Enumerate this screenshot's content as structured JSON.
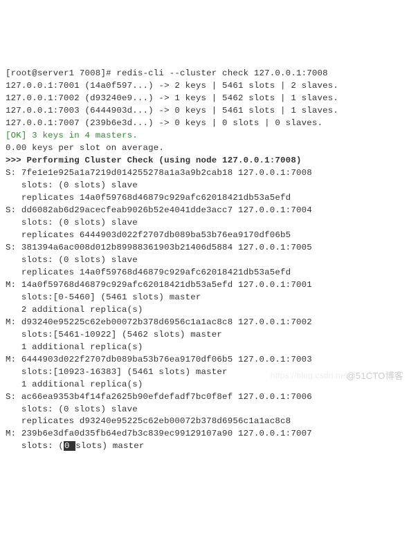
{
  "prompt": "[root@server1 7008]# redis-cli --cluster check 127.0.0.1:7008",
  "summary": [
    "127.0.0.1:7001 (14a0f597...) -> 2 keys | 5461 slots | 2 slaves.",
    "127.0.0.1:7002 (d93240e9...) -> 1 keys | 5462 slots | 1 slaves.",
    "127.0.0.1:7003 (6444903d...) -> 0 keys | 5461 slots | 1 slaves.",
    "127.0.0.1:7007 (239b6e3d...) -> 0 keys | 0 slots | 0 slaves."
  ],
  "ok_line": "[OK] 3 keys in 4 masters.",
  "avg_line": "0.00 keys per slot on average.",
  "perf_line": ">>> Performing Cluster Check (using node 127.0.0.1:7008)",
  "nodes": [
    "S: 7fe1e1e925a1a7219d014255278a1a3a9b2cab18 127.0.0.1:7008",
    "   slots: (0 slots) slave",
    "   replicates 14a0f59768d46879c929afc62018421db53a5efd",
    "S: dd6082ab6d29acecfeab9026b52e4041dde3acc7 127.0.0.1:7004",
    "   slots: (0 slots) slave",
    "   replicates 6444903d022f2707db089ba53b76ea9170df06b5",
    "S: 381394a6ac008d012b89988361903b21406d5884 127.0.0.1:7005",
    "   slots: (0 slots) slave",
    "   replicates 14a0f59768d46879c929afc62018421db53a5efd",
    "M: 14a0f59768d46879c929afc62018421db53a5efd 127.0.0.1:7001",
    "   slots:[0-5460] (5461 slots) master",
    "   2 additional replica(s)",
    "M: d93240e95225c62eb00072b378d6956c1a1ac8c8 127.0.0.1:7002",
    "   slots:[5461-10922] (5462 slots) master",
    "   1 additional replica(s)",
    "M: 6444903d022f2707db089ba53b76ea9170df06b5 127.0.0.1:7003",
    "   slots:[10923-16383] (5461 slots) master",
    "   1 additional replica(s)",
    "S: ac66ea9353b4f14fa2625b90efdefadf7bc0f8ef 127.0.0.1:7006",
    "   slots: (0 slots) slave",
    "   replicates d93240e95225c62eb00072b378d6956c1a1ac8c8",
    "M: 239b6e3dfa0d35fb64ed7b3c839ec99129107a90 127.0.0.1:7007"
  ],
  "last_line_prefix": "   slots: (",
  "last_line_highlight": "0 ",
  "last_line_suffix": "slots) master",
  "watermark": "@51CTO博客",
  "watermark2": "https://blog.csdn.net/"
}
